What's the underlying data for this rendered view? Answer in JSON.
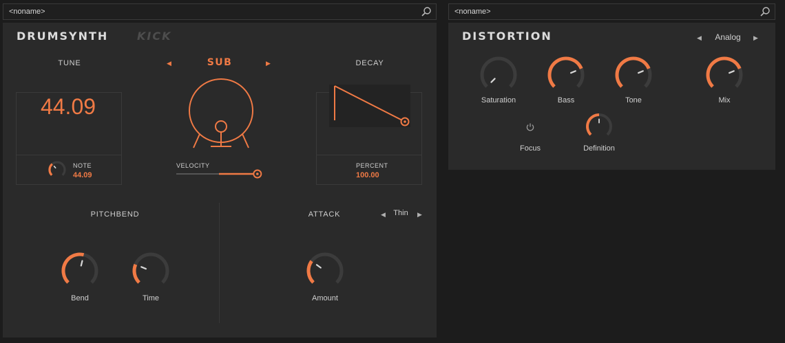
{
  "colors": {
    "accent": "#f07a45",
    "panel": "#2a2a2a",
    "track": "#3c3c3c"
  },
  "drumsynth": {
    "preset_name": "<noname>",
    "brand": "DRUMSYNTH",
    "model": "KICK",
    "tune": {
      "label": "TUNE",
      "value": "44.09",
      "note_label": "NOTE",
      "note_value": "44.09",
      "knob_level": 0.35
    },
    "engine": {
      "label": "SUB",
      "velocity_label": "VELOCITY",
      "velocity_level": 0.95
    },
    "decay": {
      "label": "DECAY",
      "percent_label": "PERCENT",
      "percent_value": "100.00"
    },
    "pitchbend": {
      "label": "PITCHBEND",
      "knobs": [
        {
          "label": "Bend",
          "level": 0.55
        },
        {
          "label": "Time",
          "level": 0.25
        }
      ]
    },
    "attack": {
      "label": "ATTACK",
      "mode": "Thin",
      "knobs": [
        {
          "label": "Amount",
          "level": 0.3
        }
      ]
    }
  },
  "distortion": {
    "preset_name": "<noname>",
    "title": "DISTORTION",
    "mode": "Analog",
    "knobs": [
      {
        "label": "Saturation",
        "level": 0.0
      },
      {
        "label": "Bass",
        "level": 0.75
      },
      {
        "label": "Tone",
        "level": 0.75
      },
      {
        "label": "Mix",
        "level": 0.75
      }
    ],
    "focus_label": "Focus",
    "definition": {
      "label": "Definition",
      "level": 0.5
    }
  }
}
